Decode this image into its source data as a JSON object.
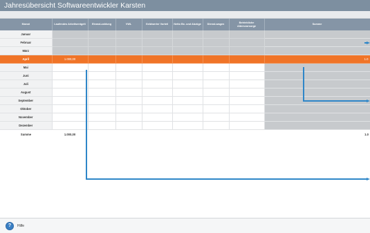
{
  "window": {
    "title": "Jahresübersicht  Softwareentwickler Karsten"
  },
  "table": {
    "columns": [
      "Monat",
      "Laufendes Arbeitsentgelt",
      "Einmal-zahlung",
      "VWL",
      "Geldwerter Vorteil",
      "Netto Be- und Abzüge",
      "Dienst-wagen",
      "Betriebliche Altersvorsorge",
      "Summe"
    ],
    "rows": [
      {
        "month": "Januar",
        "entgelt": "",
        "summe": ""
      },
      {
        "month": "Februar",
        "entgelt": "",
        "summe": ""
      },
      {
        "month": "März",
        "entgelt": "",
        "summe": ""
      },
      {
        "month": "April",
        "entgelt": "1.000,00",
        "summe": "1.0"
      },
      {
        "month": "Mai",
        "entgelt": "",
        "summe": ""
      },
      {
        "month": "Juni",
        "entgelt": "",
        "summe": ""
      },
      {
        "month": "Juli",
        "entgelt": "",
        "summe": ""
      },
      {
        "month": "August",
        "entgelt": "",
        "summe": ""
      },
      {
        "month": "September",
        "entgelt": "",
        "summe": ""
      },
      {
        "month": "Oktober",
        "entgelt": "",
        "summe": ""
      },
      {
        "month": "November",
        "entgelt": "",
        "summe": ""
      },
      {
        "month": "Dezember",
        "entgelt": "",
        "summe": ""
      }
    ],
    "total": {
      "label": "Summe",
      "entgelt": "1.000,00",
      "summe": "1.0"
    },
    "active_month": "April"
  },
  "footer": {
    "help_label": "Hilfe",
    "help_icon": "help-icon"
  },
  "colors": {
    "header": "#8595a6",
    "active_row": "#f07428",
    "annotation": "#2e86c8",
    "past_cell": "#c7cacd"
  }
}
